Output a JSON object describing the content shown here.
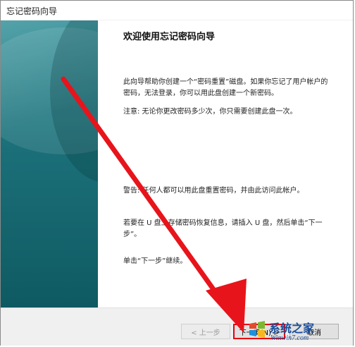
{
  "window": {
    "title": "忘记密码向导"
  },
  "content": {
    "heading": "欢迎使用忘记密码向导",
    "para1": "此向导帮助你创建一个“密码重置”磁盘。如果你忘记了用户帐户的密码，无法登录，你可以用此盘创建一个新密码。",
    "para2": "注意: 无论你更改密码多少次，你只需要创建此盘一次。",
    "para3": "警告: 任何人都可以用此盘重置密码，并由此访问此帐户。",
    "para4": "若要在 U 盘上存储密码恢复信息，请插入 U 盘，然后单击“下一步”。",
    "para5": "单击“下一步”继续。"
  },
  "buttons": {
    "back": "< 上一步",
    "next": "下一步(N) >",
    "cancel": "取消"
  },
  "watermark": {
    "cn": "系统之家",
    "en": "Winwin7.com"
  },
  "colors": {
    "side_panel": "#1b6f78",
    "arrow": "#e8141b",
    "highlight_box": "#e60012",
    "watermark": "#1a4f9c"
  },
  "icons": {
    "watermark_logo": "windows-logo-icon"
  }
}
